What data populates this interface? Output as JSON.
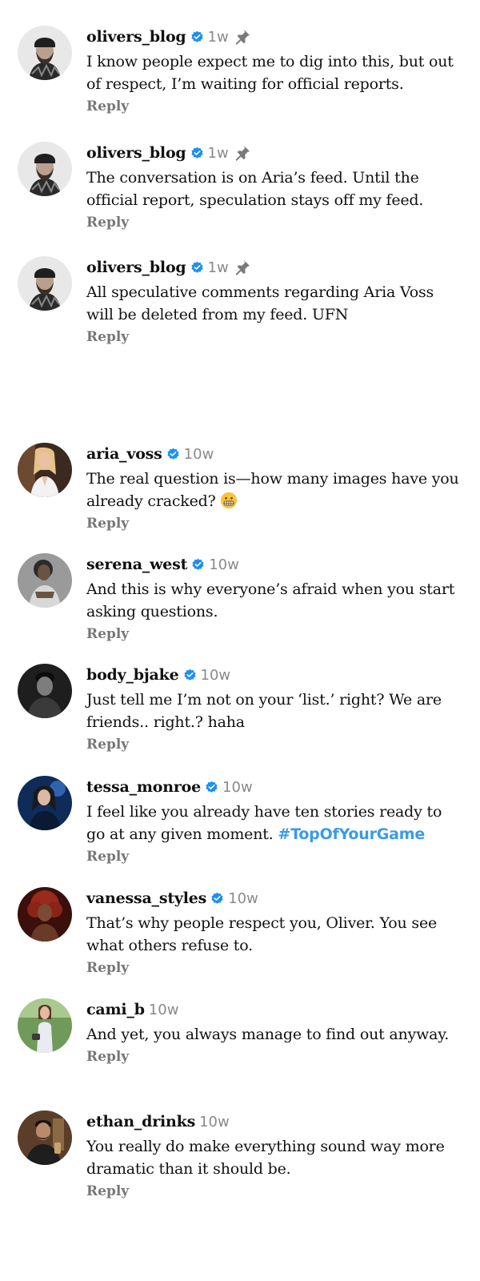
{
  "colors": {
    "verified": "#1d8ff2",
    "hashtag": "#3a9be6",
    "meta": "#8a8a8a",
    "reply": "#777777"
  },
  "reply_label": "Reply",
  "pinned_comments": [
    {
      "username": "olivers_blog",
      "verified": true,
      "time": "1w",
      "pinned": true,
      "text": "I know people expect me to dig into this, but out of respect, I’m waiting for official reports."
    },
    {
      "username": "olivers_blog",
      "verified": true,
      "time": "1w",
      "pinned": true,
      "text": "The conversation is on Aria’s feed. Until the official report, speculation stays off my feed."
    },
    {
      "username": "olivers_blog",
      "verified": true,
      "time": "1w",
      "pinned": true,
      "text": "All speculative comments regarding Aria Voss will be deleted from my feed. UFN"
    }
  ],
  "comments": [
    {
      "username": "aria_voss",
      "verified": true,
      "time": "10w",
      "text": "The real question is—how many images have you already cracked?",
      "emoji": "grimacing-face"
    },
    {
      "username": "serena_west",
      "verified": true,
      "time": "10w",
      "text": "And this is why everyone’s afraid when you start asking questions."
    },
    {
      "username": "body_bjake",
      "verified": true,
      "time": "10w",
      "text": "Just tell me I’m not on your ‘list.’ right? We are friends.. right.? haha"
    },
    {
      "username": "tessa_monroe",
      "verified": true,
      "time": "10w",
      "text": "I feel like you already have ten stories ready to go at any given moment.",
      "hashtag": "#TopOfYourGame"
    },
    {
      "username": "vanessa_styles",
      "verified": true,
      "time": "10w",
      "text": "That’s why people respect you, Oliver. You see what others refuse to."
    },
    {
      "username": "cami_b",
      "verified": false,
      "time": "10w",
      "text": "And yet, you always manage to find out anyway."
    },
    {
      "username": "ethan_drinks",
      "verified": false,
      "time": "10w",
      "text": "You really do make everything sound way more dramatic than it should be."
    }
  ]
}
